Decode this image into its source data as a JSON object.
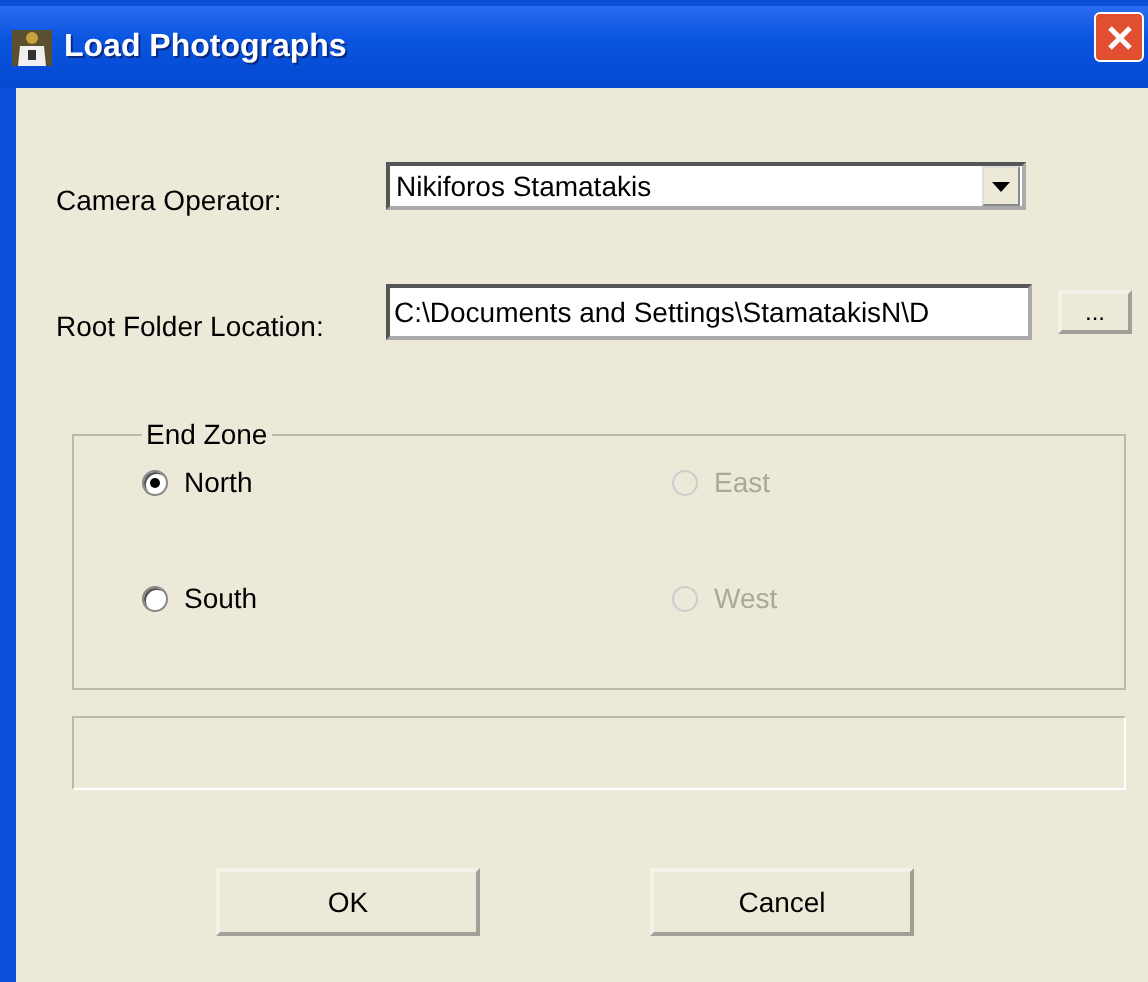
{
  "window": {
    "title": "Load Photographs"
  },
  "camera_operator": {
    "label": "Camera Operator:",
    "value": "Nikiforos Stamatakis"
  },
  "root_folder": {
    "label": "Root Folder Location:",
    "value": "C:\\Documents and Settings\\StamatakisN\\D",
    "browse": "..."
  },
  "end_zone": {
    "title": "End Zone",
    "options": [
      {
        "label": "North",
        "selected": true,
        "disabled": false
      },
      {
        "label": "East",
        "selected": false,
        "disabled": true
      },
      {
        "label": "South",
        "selected": false,
        "disabled": false
      },
      {
        "label": "West",
        "selected": false,
        "disabled": true
      }
    ]
  },
  "buttons": [
    "OK",
    "Cancel"
  ]
}
